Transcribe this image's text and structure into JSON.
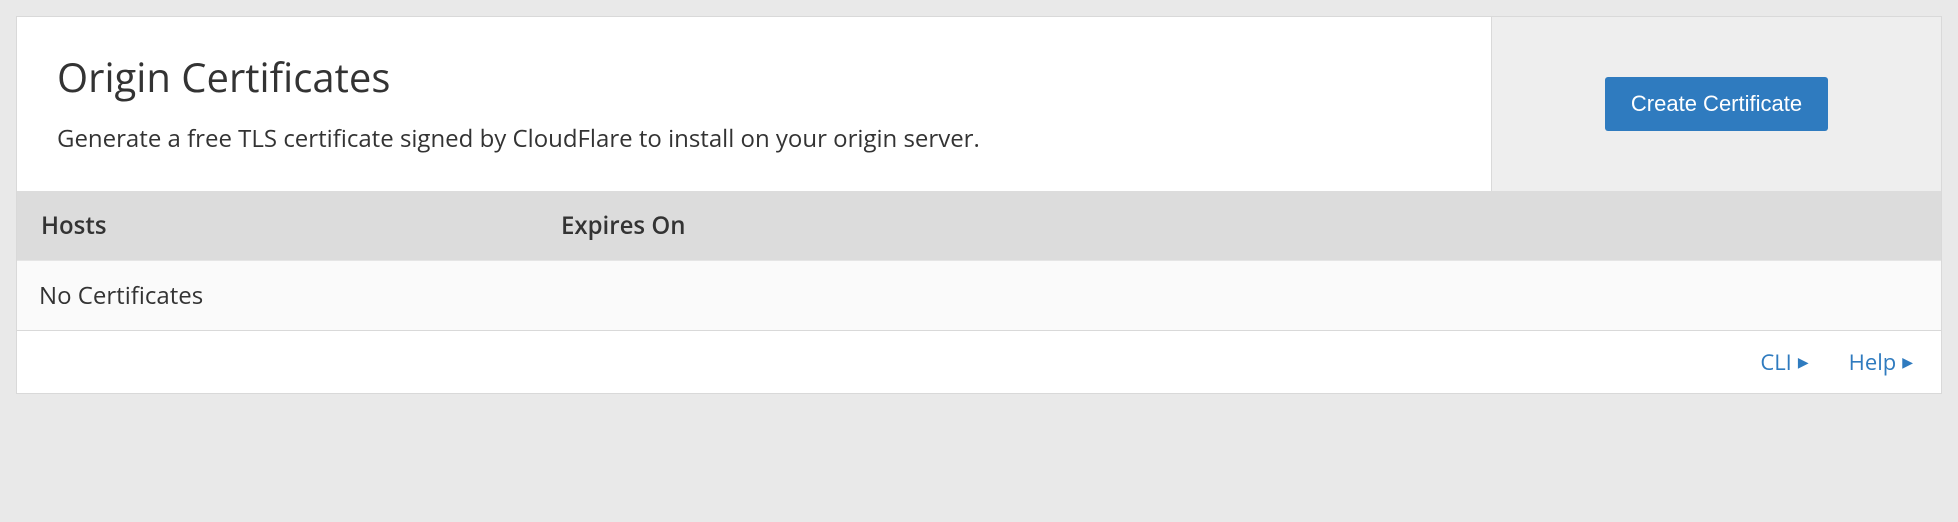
{
  "header": {
    "title": "Origin Certificates",
    "description": "Generate a free TLS certificate signed by CloudFlare to install on your origin server.",
    "action_label": "Create Certificate"
  },
  "table": {
    "columns": {
      "hosts": "Hosts",
      "expires": "Expires On"
    },
    "empty_message": "No Certificates"
  },
  "footer": {
    "cli_label": "CLI",
    "help_label": "Help"
  }
}
